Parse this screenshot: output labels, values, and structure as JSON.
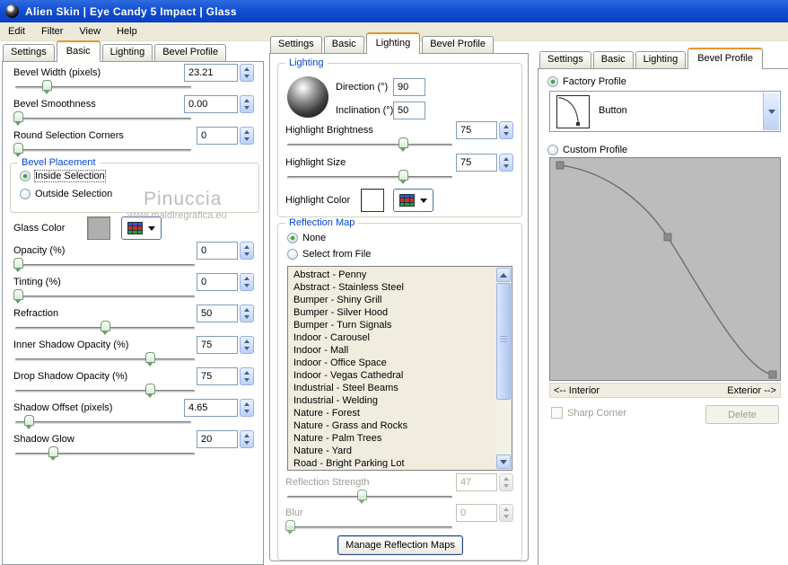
{
  "window": {
    "title": "Alien Skin  |  Eye Candy 5 Impact  |  Glass"
  },
  "menu": {
    "items": [
      "Edit",
      "Filter",
      "View",
      "Help"
    ]
  },
  "tabs": [
    "Settings",
    "Basic",
    "Lighting",
    "Bevel Profile"
  ],
  "colors": {
    "titlebar": "#1150D2",
    "tab_accent": "#E8962E",
    "group_title": "#0046D5",
    "glass_color_swatch": "#AFAFAF",
    "highlight_color_swatch": "#FFFFFF"
  },
  "icons": [
    "alien-skin-logo-icon",
    "color-grid-picker-icon",
    "dropdown-arrow-icon",
    "spinner-up-icon",
    "spinner-down-icon",
    "scroll-up-icon",
    "scroll-down-icon",
    "light-sphere-icon",
    "profile-curve-thumbnail-icon"
  ],
  "panels": {
    "basic": {
      "selected_tab": "Basic",
      "rows": [
        {
          "label": "Bevel Width (pixels)",
          "value": "23.21"
        },
        {
          "label": "Bevel Smoothness",
          "value": "0.00"
        },
        {
          "label": "Round Selection Corners",
          "value": "0"
        },
        {
          "label": "Opacity (%)",
          "value": "0"
        },
        {
          "label": "Tinting (%)",
          "value": "0"
        },
        {
          "label": "Refraction",
          "value": "50"
        },
        {
          "label": "Inner Shadow Opacity (%)",
          "value": "75"
        },
        {
          "label": "Drop Shadow Opacity (%)",
          "value": "75"
        },
        {
          "label": "Shadow Offset (pixels)",
          "value": "4.65"
        },
        {
          "label": "Shadow Glow",
          "value": "20"
        }
      ],
      "bevel_placement": {
        "title": "Bevel Placement",
        "options": [
          "Inside Selection",
          "Outside Selection"
        ],
        "selected": "Inside Selection"
      },
      "glass_color_label": "Glass Color",
      "watermark": {
        "name": "Pinuccia",
        "url": "www.maidiregrafica.eu"
      }
    },
    "lighting": {
      "selected_tab": "Lighting",
      "group_title": "Lighting",
      "direction": {
        "label": "Direction (°)",
        "value": "90"
      },
      "inclination": {
        "label": "Inclination (°)",
        "value": "50"
      },
      "rows": [
        {
          "label": "Highlight Brightness",
          "value": "75"
        },
        {
          "label": "Highlight Size",
          "value": "75"
        }
      ],
      "highlight_color_label": "Highlight Color",
      "reflection": {
        "group_title": "Reflection Map",
        "none_label": "None",
        "selected": "None",
        "select_label": "Select from File",
        "items": [
          "Abstract - Penny",
          "Abstract - Stainless Steel",
          "Bumper - Shiny Grill",
          "Bumper - Silver Hood",
          "Bumper - Turn Signals",
          "Indoor - Carousel",
          "Indoor - Mall",
          "Indoor - Office Space",
          "Indoor - Vegas Cathedral",
          "Industrial - Steel Beams",
          "Industrial - Welding",
          "Nature - Forest",
          "Nature - Grass and Rocks",
          "Nature - Palm Trees",
          "Nature - Yard",
          "Road - Bright Parking Lot"
        ],
        "strength": {
          "label": "Reflection Strength",
          "value": "47",
          "disabled": true
        },
        "blur": {
          "label": "Blur",
          "value": "0",
          "disabled": true
        },
        "manage_button": "Manage Reflection Maps"
      }
    },
    "profile": {
      "selected_tab": "Bevel Profile",
      "factory_label": "Factory Profile",
      "factory_selected": true,
      "profile_name": "Button",
      "custom_label": "Custom Profile",
      "interior_label": "<-- Interior",
      "exterior_label": "Exterior -->",
      "sharp_corner_label": "Sharp Corner",
      "sharp_corner_disabled": true,
      "delete_button": "Delete",
      "delete_disabled": true
    }
  }
}
